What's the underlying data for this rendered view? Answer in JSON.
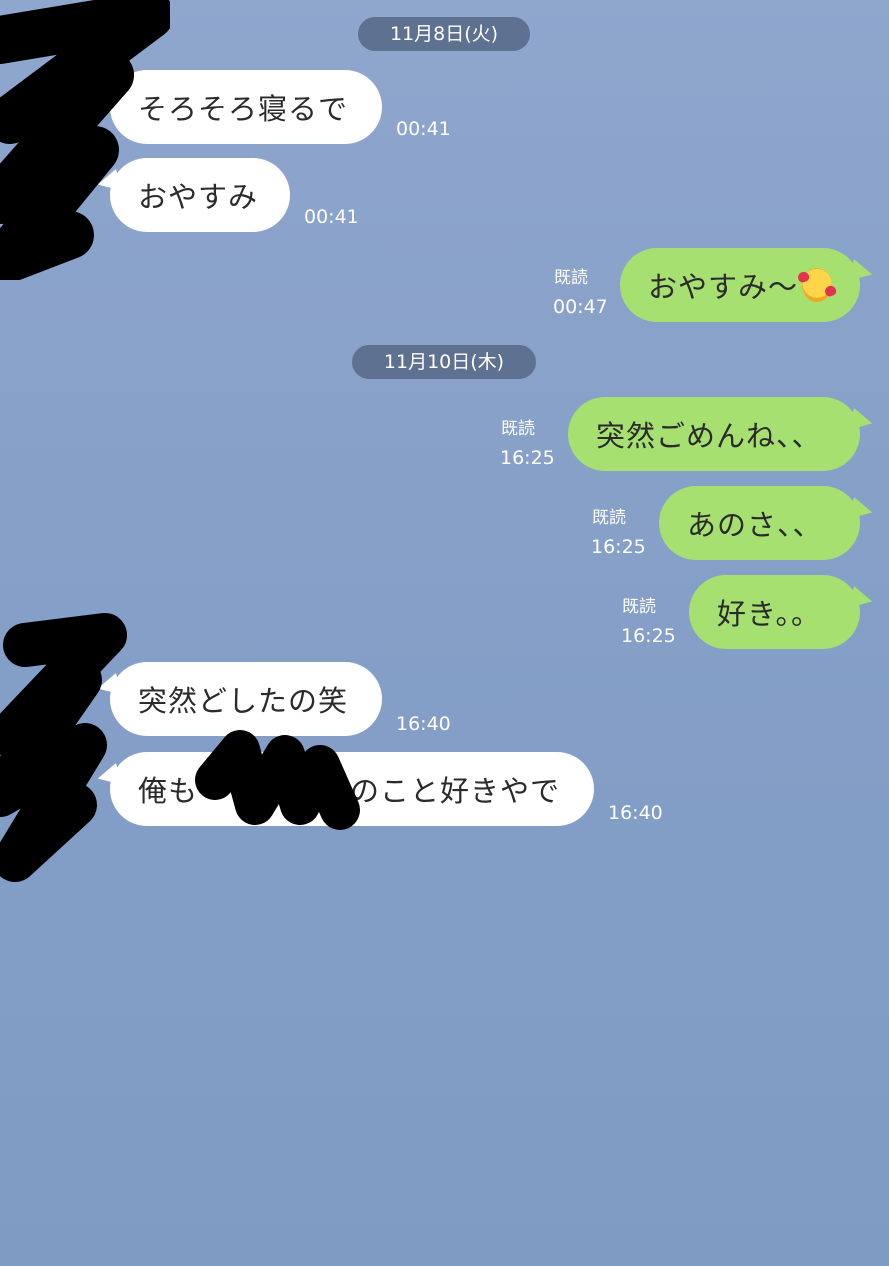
{
  "chat": {
    "dates": [
      "11月8日(火)",
      "11月10日(木)"
    ],
    "read_label": "既読",
    "messages": [
      {
        "side": "in",
        "text": "そろそろ寝るで",
        "time": "00:41"
      },
      {
        "side": "in",
        "text": "おやすみ",
        "time": "00:41"
      },
      {
        "side": "out",
        "text": "おやすみ〜",
        "emoji": "smiling-face-with-hearts",
        "time": "00:47",
        "read": true
      },
      {
        "side": "out",
        "text": "突然ごめんね、、",
        "time": "16:25",
        "read": true
      },
      {
        "side": "out",
        "text": "あのさ、、",
        "time": "16:25",
        "read": true
      },
      {
        "side": "out",
        "text": "好き。。",
        "time": "16:25",
        "read": true
      },
      {
        "side": "in",
        "text": "突然どしたの笑",
        "time": "16:40"
      },
      {
        "side": "in",
        "text_before": "俺も",
        "text_after": "のこと好きやで",
        "time": "16:40"
      }
    ]
  },
  "colors": {
    "background": "#86a0c8",
    "date_pill": "#5f7191",
    "incoming_bubble": "#ffffff",
    "outgoing_bubble": "#a6e071",
    "redaction": "#000000"
  }
}
